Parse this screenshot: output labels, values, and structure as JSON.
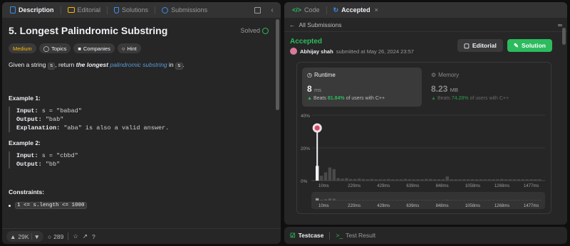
{
  "left_tabs": [
    {
      "label": "Description",
      "active": true,
      "color": "#3a8ee6"
    },
    {
      "label": "Editorial",
      "active": false,
      "color": "#ffb800"
    },
    {
      "label": "Solutions",
      "active": false,
      "color": "#3a8ee6"
    },
    {
      "label": "Submissions",
      "active": false,
      "color": "#3a8ee6"
    }
  ],
  "problem": {
    "title": "5. Longest Palindromic Substring",
    "status": "Solved",
    "tags": [
      {
        "label": "Medium",
        "icon": ""
      },
      {
        "label": "Topics",
        "icon": "tag-icon"
      },
      {
        "label": "Companies",
        "icon": "lock-icon"
      },
      {
        "label": "Hint",
        "icon": "lightbulb-icon"
      }
    ],
    "desc_pre": "Given a string ",
    "desc_var": "s",
    "desc_mid": ", return ",
    "desc_em": "the longest",
    "desc_link": "palindromic substring",
    "desc_in": " in ",
    "desc_var2": "s",
    "desc_end": "."
  },
  "examples": [
    {
      "title": "Example 1:",
      "input_label": "Input:",
      "input": "s = \"babad\"",
      "output_label": "Output:",
      "output": "\"bab\"",
      "explanation_label": "Explanation:",
      "explanation": "\"aba\" is also a valid answer."
    },
    {
      "title": "Example 2:",
      "input_label": "Input:",
      "input": "s = \"cbbd\"",
      "output_label": "Output:",
      "output": "\"bb\""
    }
  ],
  "constraints_title": "Constraints:",
  "constraints": [
    "1 <= s.length <= 1000"
  ],
  "footer": {
    "likes": "29K",
    "comments": "289"
  },
  "right_tabs": [
    {
      "label": "Code",
      "active": false
    },
    {
      "label": "Accepted",
      "active": true
    }
  ],
  "sub_header": "All Submissions",
  "result": {
    "status": "Accepted",
    "user": "Abhijay shah",
    "submitted": "submitted at May 26, 2024 23:57",
    "editorial_btn": "Editorial",
    "solution_btn": "Solution"
  },
  "runtime": {
    "label": "Runtime",
    "value": "8",
    "unit": "ms",
    "beats_label": "Beats",
    "pct": "81.84%",
    "suffix": "of users with C++"
  },
  "memory": {
    "label": "Memory",
    "value": "8.23",
    "unit": "MB",
    "beats_label": "Beats",
    "pct": "74.28%",
    "suffix": "of users with C++"
  },
  "bottom_tabs": [
    {
      "label": "Testcase",
      "active": true
    },
    {
      "label": "Test Result",
      "active": false
    }
  ],
  "chart_data": {
    "type": "bar",
    "ylim": [
      0,
      40
    ],
    "yticks": [
      "40%",
      "20%",
      "0%"
    ],
    "xticks": [
      "10ms",
      "220ms",
      "429ms",
      "639ms",
      "848ms",
      "1058ms",
      "1268ms",
      "1477ms"
    ],
    "values": [
      9,
      3,
      5,
      8,
      7,
      1.5,
      1.2,
      1.5,
      1,
      1,
      1.2,
      1,
      0.8,
      1,
      0.8,
      0.8,
      0.8,
      1,
      0.8,
      0.8,
      0.8,
      1,
      0.8,
      0.8,
      0.8,
      0.8,
      1,
      1,
      0.8,
      0.8,
      0.8,
      2.5,
      0.8,
      0.8,
      0.8,
      0.8,
      0.8,
      0.8,
      0.8,
      0.8,
      0.8,
      0.8,
      0.8,
      0.8,
      1,
      0.8,
      0.8,
      0.8,
      0.8,
      0.8,
      0.8,
      0.8,
      0.8,
      0.8
    ],
    "highlight_index": 0,
    "grid": true
  }
}
